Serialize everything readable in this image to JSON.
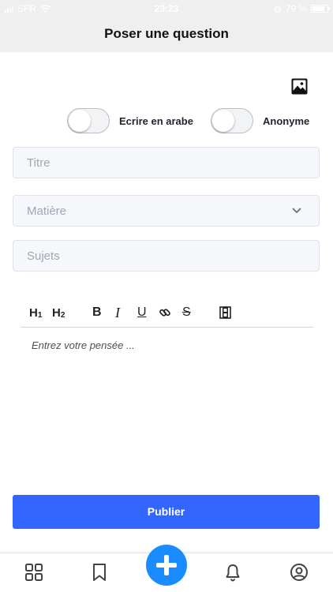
{
  "status_bar": {
    "carrier": "SFR",
    "time": "23:23",
    "battery": "79 %"
  },
  "header": {
    "title": "Poser une question"
  },
  "toggles": [
    {
      "label": "Ecrire en arabe",
      "on": false
    },
    {
      "label": "Anonyme",
      "on": false
    }
  ],
  "form": {
    "title_placeholder": "Titre",
    "subject_select": "Matière",
    "topics_placeholder": "Sujets"
  },
  "editor": {
    "toolbar": [
      {
        "label": "H",
        "sub": "1",
        "icon": "heading-1"
      },
      {
        "label": "H",
        "sub": "2",
        "icon": "heading-2"
      },
      {
        "label": "B",
        "icon": "bold"
      },
      {
        "label": "I",
        "icon": "italic"
      },
      {
        "label": "U",
        "icon": "underline"
      },
      {
        "label": "",
        "icon": "link-icon"
      },
      {
        "label": "S",
        "icon": "strikethrough"
      },
      {
        "label": "",
        "icon": "video-icon"
      }
    ],
    "placeholder": "Entrez votre pensée ..."
  },
  "actions": {
    "publish_label": "Publier"
  },
  "bottom_nav": {
    "items": [
      "grid-icon",
      "bookmark-icon",
      "add-icon",
      "bell-icon",
      "profile-icon"
    ],
    "accent": "#1a8cff"
  },
  "colors": {
    "primary_button": "#3366ff",
    "fab": "#1a8cff"
  }
}
